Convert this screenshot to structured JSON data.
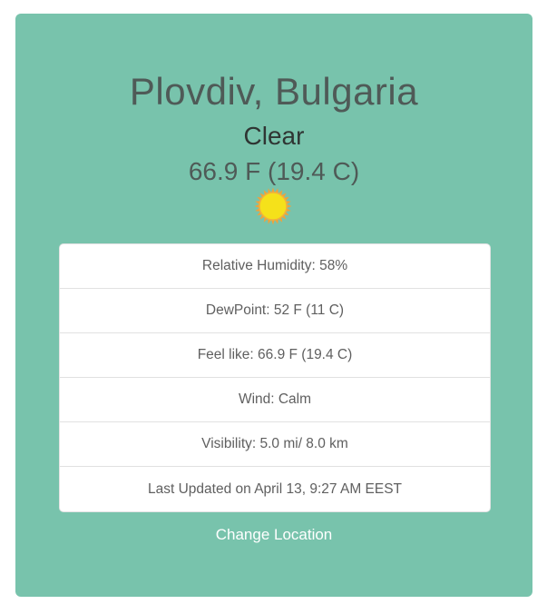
{
  "location": {
    "city": "Plovdiv, Bulgaria",
    "condition": "Clear",
    "temperature": "66.9 F (19.4 C)",
    "icon": "sun-icon"
  },
  "details": [
    {
      "text": "Relative Humidity: 58%"
    },
    {
      "text": "DewPoint: 52 F (11 C)"
    },
    {
      "text": "Feel like: 66.9 F (19.4 C)"
    },
    {
      "text": "Wind: Calm"
    },
    {
      "text": "Visibility: 5.0 mi/ 8.0 km"
    },
    {
      "text": "Last Updated on April 13, 9:27 AM EEST"
    }
  ],
  "actions": {
    "change_location": "Change Location"
  },
  "colors": {
    "card": "#78c3ac",
    "sun_fill": "#f5e11a",
    "sun_ray": "#f0a23a"
  }
}
